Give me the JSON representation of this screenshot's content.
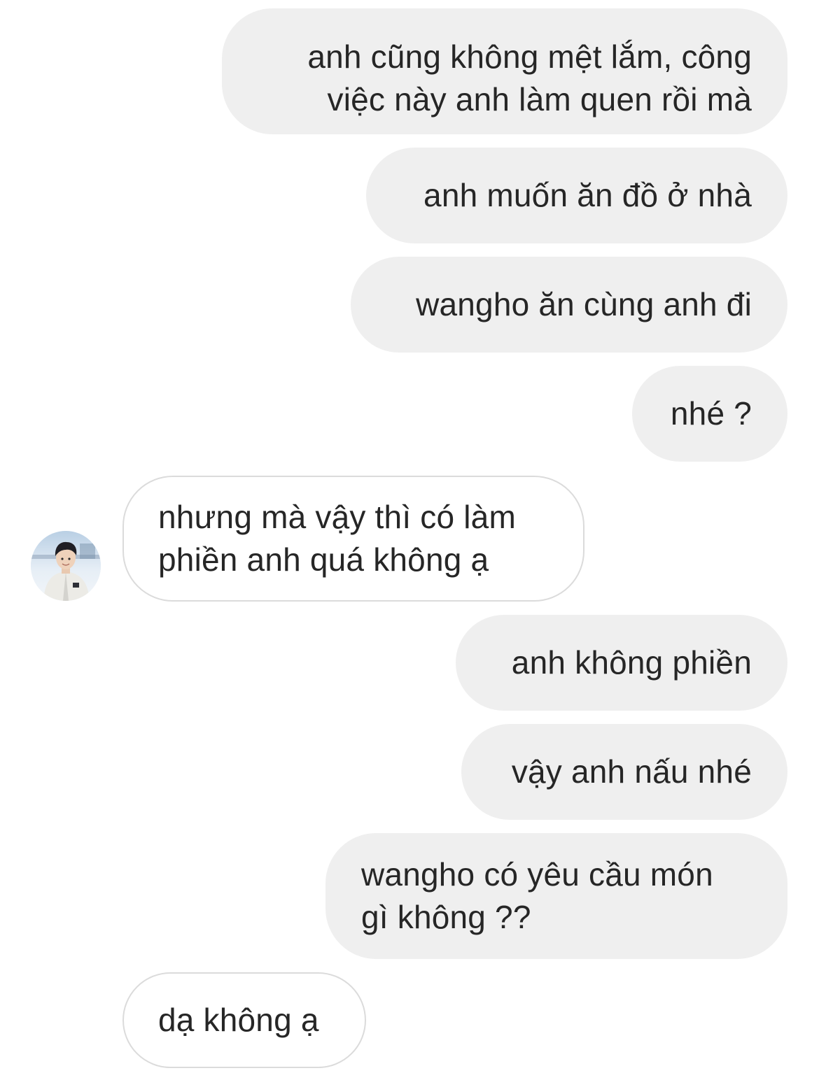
{
  "messages": [
    {
      "direction": "outgoing",
      "lines": [
        "anh cũng không mệt lắm, công",
        "việc này anh làm quen rồi mà"
      ]
    },
    {
      "direction": "outgoing",
      "lines": [
        "anh muốn ăn đồ ở nhà"
      ]
    },
    {
      "direction": "outgoing",
      "lines": [
        "wangho ăn cùng anh đi"
      ]
    },
    {
      "direction": "outgoing",
      "lines": [
        "nhé ?"
      ]
    },
    {
      "direction": "incoming",
      "lines": [
        "nhưng mà vậy thì có làm",
        "phiền anh quá không ạ"
      ]
    },
    {
      "direction": "outgoing",
      "lines": [
        "anh không phiền"
      ]
    },
    {
      "direction": "outgoing",
      "lines": [
        "vậy anh nấu nhé"
      ]
    },
    {
      "direction": "outgoing",
      "lines": [
        "wangho có yêu cầu món",
        "gì không ??"
      ]
    },
    {
      "direction": "incoming",
      "lines": [
        "dạ không ạ"
      ]
    }
  ],
  "avatar": {
    "icon": "contact-avatar-photo"
  },
  "colors": {
    "outgoing_bubble": "#efefef",
    "incoming_bubble": "#ffffff",
    "incoming_border": "#dbdbdb",
    "text": "#262626"
  }
}
